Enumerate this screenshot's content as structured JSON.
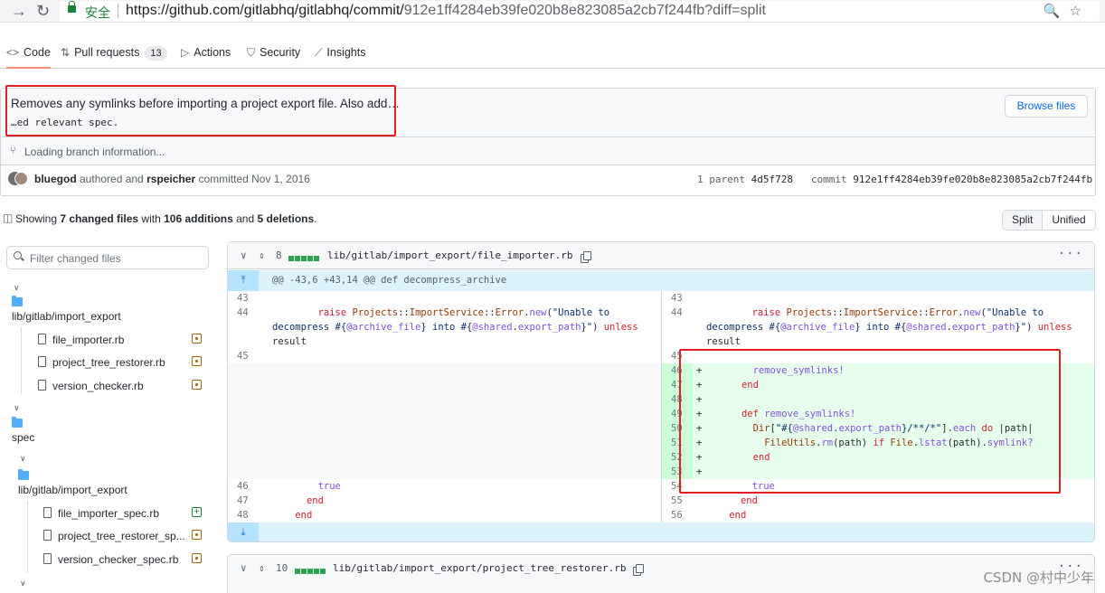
{
  "browser": {
    "secure_label": "安全",
    "url_main": "https://github.com/gitlabhq/gitlabhq/commit/",
    "url_tail": "912e1ff4284eb39fe020b8e823085a2cb7f244fb?diff=split"
  },
  "repo_nav": {
    "tabs": [
      {
        "label": "Code"
      },
      {
        "label": "Pull requests",
        "count": "13"
      },
      {
        "label": "Actions"
      },
      {
        "label": "Security"
      },
      {
        "label": "Insights"
      }
    ]
  },
  "commit": {
    "title": "Removes any symlinks before importing a project export file. Also add…",
    "description": "…ed relevant spec.",
    "browse_label": "Browse files",
    "branch_info": "Loading branch information...",
    "author": "bluegod",
    "authored_text": " authored and ",
    "committer": "rspeicher",
    "committed_text": " committed Nov 1, 2016",
    "parent_label": "1 parent",
    "parent_sha": "4d5f728",
    "commit_label": "commit",
    "commit_sha": "912e1ff4284eb39fe020b8e823085a2cb7f244fb"
  },
  "summary": {
    "prefix": "Showing ",
    "files": "7 changed files",
    "with": " with ",
    "additions": "106 additions",
    "and": " and ",
    "deletions": "5 deletions",
    "suffix": ".",
    "split_label": "Split",
    "unified_label": "Unified"
  },
  "file_tree": {
    "filter_placeholder": "Filter changed files",
    "folder1": "lib/gitlab/import_export",
    "folder1_files": [
      "file_importer.rb",
      "project_tree_restorer.rb",
      "version_checker.rb"
    ],
    "folder2": "spec",
    "folder3": "lib/gitlab/import_export",
    "folder3_files": [
      "file_importer_spec.rb",
      "project_tree_restorer_sp...",
      "version_checker_spec.rb"
    ]
  },
  "diff1": {
    "changes": "8",
    "path": "lib/gitlab/import_export/file_importer.rb",
    "hunk": "@@ -43,6 +43,14 @@ def decompress_archive",
    "left_nums": [
      "43",
      "44",
      "45",
      "46",
      "47",
      "48"
    ],
    "right_nums": [
      "43",
      "44",
      "45",
      "46",
      "47",
      "48",
      "49",
      "50",
      "51",
      "52",
      "53",
      "54",
      "55",
      "56"
    ],
    "added_lines": [
      "        remove_symlinks!",
      "      end",
      "",
      "      def remove_symlinks!",
      "        Dir[\"#{@shared.export_path}/**/*\"].each do |path|",
      "          FileUtils.rm(path) if File.lstat(path).symlink?",
      "        end",
      ""
    ]
  },
  "diff2": {
    "changes": "10",
    "path": "lib/gitlab/import_export/project_tree_restorer.rb"
  },
  "watermark": "CSDN @村中少年"
}
